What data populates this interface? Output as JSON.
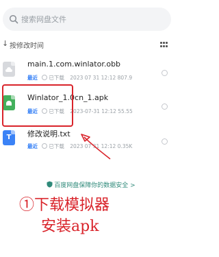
{
  "search": {
    "placeholder": "搜索网盘文件"
  },
  "sort": {
    "label": "按修改时间"
  },
  "files": [
    {
      "name": "main.1.com.winlator.obb",
      "badge": "最近",
      "status": "已下载",
      "date": "2023 07 31",
      "time": "12:12",
      "size": "807.9",
      "icon": "archive-icon",
      "color": "#d7d9dd"
    },
    {
      "name": "Winlator_1.0cn_1.apk",
      "badge": "最近",
      "status": "已下载",
      "date": "2023-07-31",
      "time": "12:12",
      "size": "55.55",
      "icon": "apk-icon",
      "color": "#43b05c"
    },
    {
      "name": "修改说明.txt",
      "badge": "最近",
      "status": "已下载",
      "date": "2023 07 31",
      "time": "12:12",
      "size": "0.35K",
      "icon": "text-file-icon",
      "color": "#3b82f6"
    }
  ],
  "notice": "百度网盘保障你的数据安全 >",
  "annotation": {
    "line1": "①下载模拟器",
    "line2": "安装apk"
  },
  "colors": {
    "highlight": "#d9232a",
    "badge": "#2f7cf6",
    "notice": "#2f8a7a"
  }
}
